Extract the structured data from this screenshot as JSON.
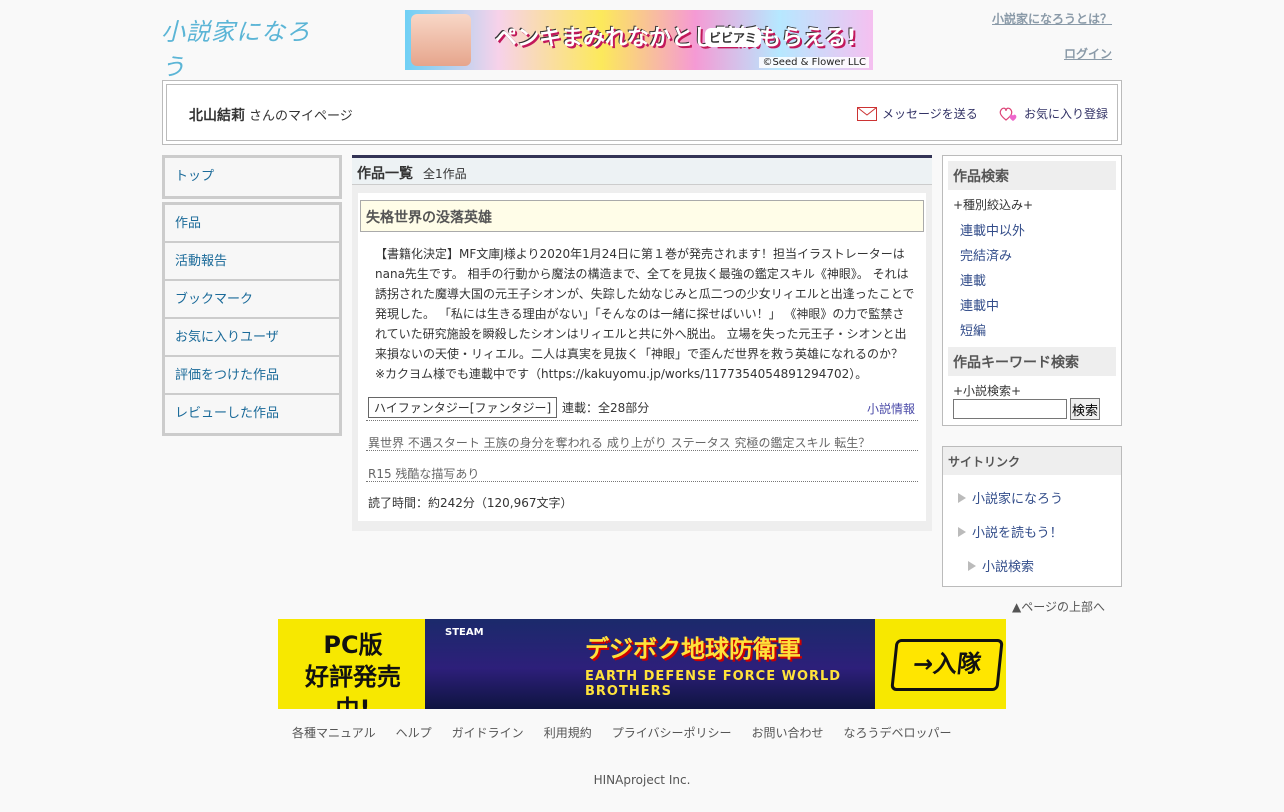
{
  "header": {
    "logo_text": "小説家になろう",
    "about_label": "小説家になろうとは？",
    "login_label": "ログイン",
    "top_ad": {
      "headline": "ペンキまみれなかとし壁紙もらえる!",
      "badge": "ビビアミ",
      "copyright": "©Seed & Flower LLC"
    }
  },
  "mypage": {
    "user_name": "北山結莉",
    "suffix": "さんのマイページ",
    "send_message_label": "メッセージを送る",
    "favorite_label": "お気に入り登録"
  },
  "left_nav": {
    "top_label": "トップ",
    "items": [
      {
        "label": "作品"
      },
      {
        "label": "活動報告"
      },
      {
        "label": "ブックマーク"
      },
      {
        "label": "お気に入りユーザ"
      },
      {
        "label": "評価をつけた作品"
      },
      {
        "label": "レビューした作品"
      }
    ]
  },
  "main": {
    "heading": "作品一覧",
    "count": "全1作品",
    "work": {
      "title": "失格世界の没落英雄",
      "summary": "【書籍化決定】MF文庫J様より2020年1月24日に第１巻が発売されます！担当イラストレーターはnana先生です。 相手の行動から魔法の構造まで、全てを見抜く最強の鑑定スキル《神眼》。 それは誘拐された魔導大国の元王子シオンが、失踪した幼なじみと瓜二つの少女リィエルと出逢ったことで発現した。 「私には生きる理由がない」「そんなのは一緒に探せばいい！」 《神眼》の力で監禁されていた研究施設を瞬殺したシオンはリィエルと共に外へ脱出。 立場を失った元王子・シオンと出来損ないの天使・リィエル。二人は真実を見抜く「神眼」で歪んだ世界を救う英雄になれるのか？ ※カクヨム様でも連載中です（https://kakuyomu.jp/works/1177354054891294702）。",
      "genre": "ハイファンタジー[ファンタジー]",
      "serial": "連載：全28部分",
      "info_link": "小説情報",
      "keywords": "異世界 不遇スタート 王族の身分を奪われる 成り上がり ステータス 究極の鑑定スキル 転生？",
      "rating": "R15 残酷な描写あり",
      "read_time": "読了時間：約242分（120,967文字）"
    }
  },
  "right_search": {
    "title": "作品検索",
    "filter_label": "+種別絞込み+",
    "filters": [
      "連載中以外",
      "完結済み",
      "連載",
      "連載中",
      "短編"
    ],
    "keyword_title": "作品キーワード検索",
    "keyword_label": "+小説検索+",
    "search_input_value": "",
    "search_button": "検索"
  },
  "site_links": {
    "title": "サイトリンク",
    "items": [
      "小説家になろう",
      "小説を読もう！",
      "小説検索"
    ]
  },
  "page_top_label": "▲ページの上部へ",
  "bottom_ad": {
    "left_text_1": "PC版",
    "left_text_2": "好評発売中!",
    "steam": "STEAM",
    "title": "デジボク地球防衛軍",
    "subtitle": "EARTH DEFENSE FORCE WORLD BROTHERS",
    "join_label": "→入隊"
  },
  "footer": {
    "links": [
      "各種マニュアル",
      "ヘルプ",
      "ガイドライン",
      "利用規約",
      "プライバシーポリシー",
      "お問い合わせ",
      "なろうデベロッパー"
    ],
    "copyright": "HINAproject Inc."
  },
  "colors": {
    "link": "#1a6a99",
    "logo": "#5bb5d6",
    "title_bg": "#fffde8"
  }
}
